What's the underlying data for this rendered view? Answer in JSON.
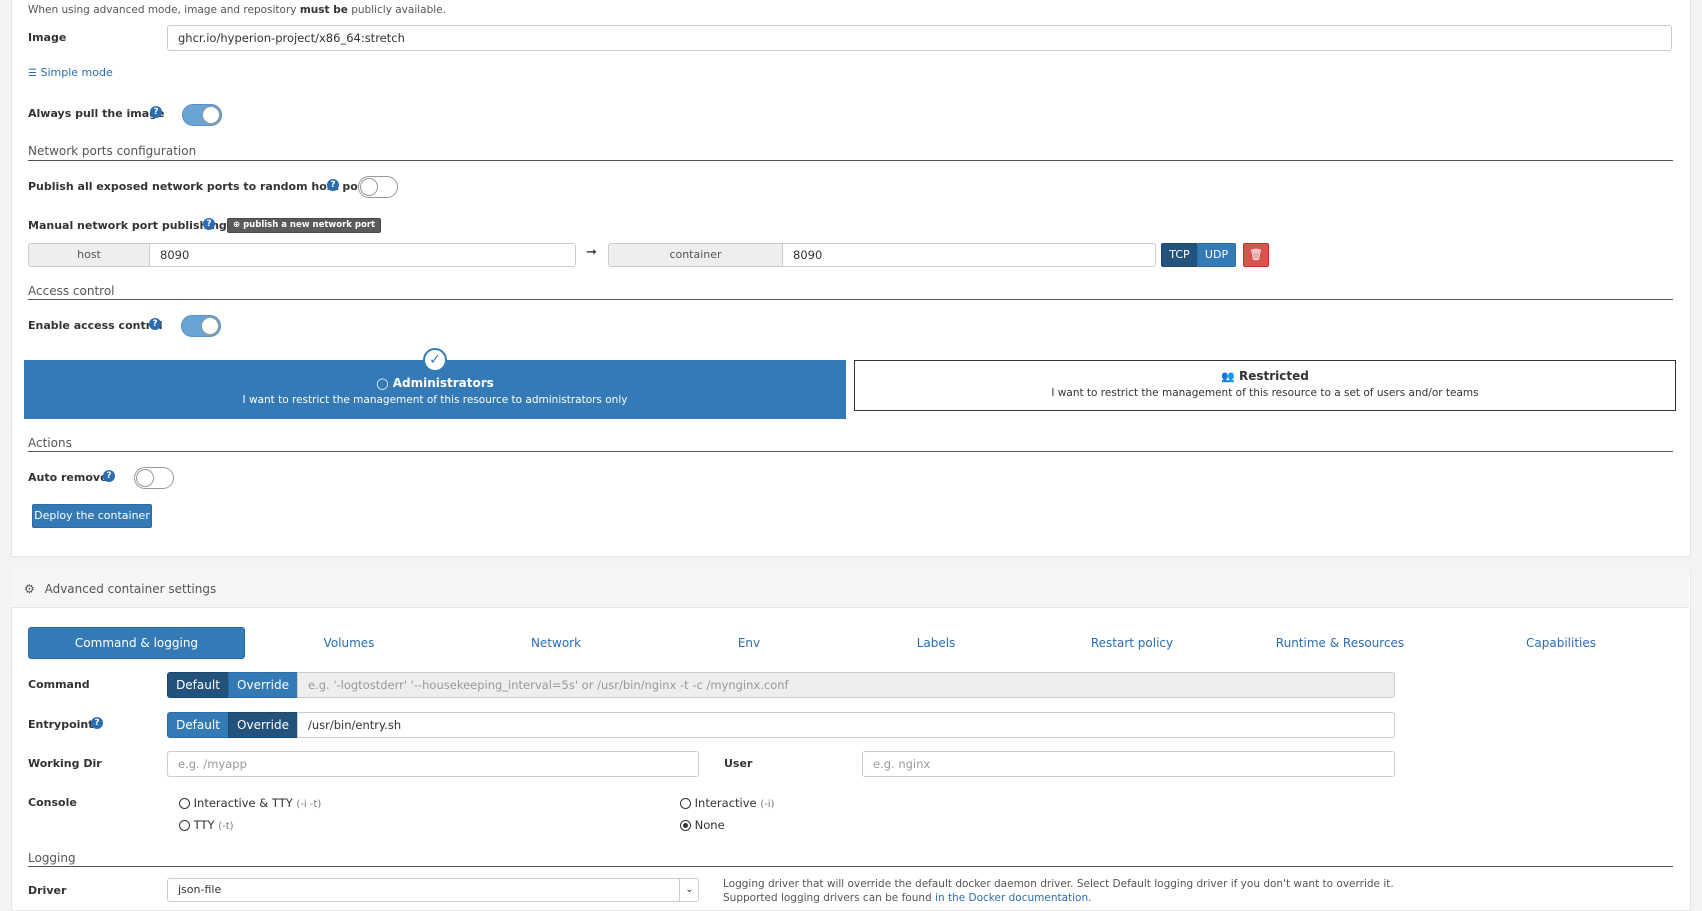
{
  "notice": {
    "prefix": "When using advanced mode, image and repository",
    "bold": "must be",
    "suffix": "publicly available."
  },
  "image": {
    "label": "Image",
    "value": "ghcr.io/hyperion-project/x86_64:stretch",
    "simple_mode_link": "Simple mode"
  },
  "always_pull": {
    "label": "Always pull the image",
    "enabled": true
  },
  "network": {
    "section_title": "Network ports configuration",
    "publish_all_label": "Publish all exposed network ports to random host ports",
    "publish_all_enabled": false,
    "manual_label": "Manual network port publishing",
    "publish_button": "publish a new network port",
    "host_label": "host",
    "host_value": "8090",
    "container_label": "container",
    "container_value": "8090",
    "tcp_label": "TCP",
    "udp_label": "UDP"
  },
  "access": {
    "section_title": "Access control",
    "enable_label": "Enable access control",
    "enabled": true,
    "admin_title": "Administrators",
    "admin_desc": "I want to restrict the management of this resource to administrators only",
    "restricted_title": "Restricted",
    "restricted_desc": "I want to restrict the management of this resource to a set of users and/or teams"
  },
  "actions": {
    "section_title": "Actions",
    "auto_remove_label": "Auto remove",
    "auto_remove_enabled": false,
    "deploy_button": "Deploy the container"
  },
  "advanced": {
    "title": "Advanced container settings",
    "tabs": [
      {
        "label": "Command & logging",
        "active": true
      },
      {
        "label": "Volumes"
      },
      {
        "label": "Network"
      },
      {
        "label": "Env"
      },
      {
        "label": "Labels"
      },
      {
        "label": "Restart policy"
      },
      {
        "label": "Runtime & Resources"
      },
      {
        "label": "Capabilities"
      }
    ],
    "command": {
      "label": "Command",
      "default_btn": "Default",
      "override_btn": "Override",
      "placeholder": "e.g. '-logtostderr' '--housekeeping_interval=5s' or /usr/bin/nginx -t -c /mynginx.conf"
    },
    "entrypoint": {
      "label": "Entrypoint",
      "default_btn": "Default",
      "override_btn": "Override",
      "value": "/usr/bin/entry.sh"
    },
    "working_dir": {
      "label": "Working Dir",
      "placeholder": "e.g. /myapp"
    },
    "user": {
      "label": "User",
      "placeholder": "e.g. nginx"
    },
    "console": {
      "label": "Console",
      "options": [
        {
          "label": "Interactive & TTY",
          "hint": "(-i -t)",
          "checked": false
        },
        {
          "label": "Interactive",
          "hint": "(-i)",
          "checked": false
        },
        {
          "label": "TTY",
          "hint": "(-t)",
          "checked": false
        },
        {
          "label": "None",
          "hint": "",
          "checked": true
        }
      ]
    },
    "logging": {
      "section_title": "Logging",
      "driver_label": "Driver",
      "driver_value": "json-file",
      "help_text": "Logging driver that will override the default docker daemon driver. Select Default logging driver if you don't want to override it. Supported logging drivers can be found",
      "help_link": "in the Docker documentation",
      "help_end": "."
    }
  },
  "colors": {
    "primary": "#337ab7",
    "primary_dark": "#23527c",
    "danger": "#d9534f",
    "link": "#2a6db2"
  }
}
